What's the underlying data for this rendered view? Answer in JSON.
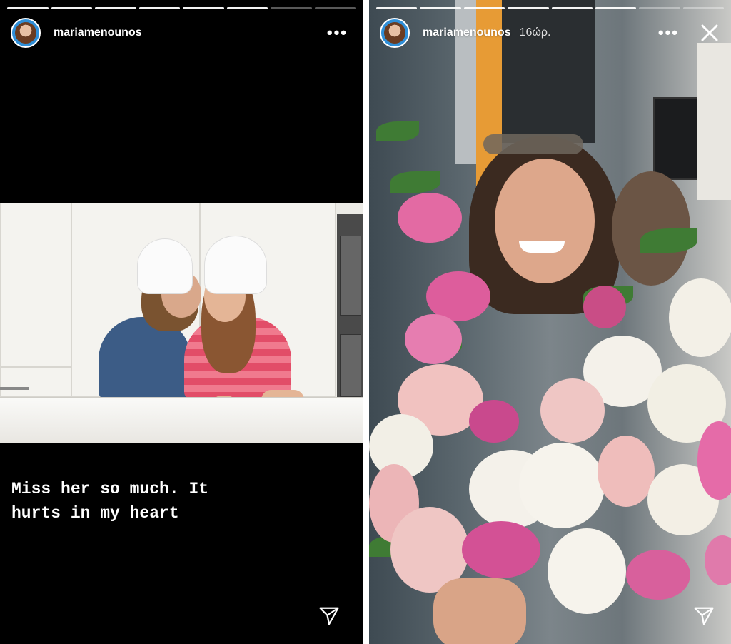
{
  "stories": [
    {
      "username": "mariamenounos",
      "timestamp": "",
      "more_label": "•••",
      "caption": "Miss her so much. It\nhurts in my heart",
      "progress": {
        "segments": 8,
        "completed": 6
      }
    },
    {
      "username": "mariamenounos",
      "timestamp": "16ώρ.",
      "more_label": "•••",
      "caption": "",
      "progress": {
        "segments": 8,
        "completed": 6
      }
    }
  ],
  "icons": {
    "avatar": "profile-avatar",
    "more": "more-options-icon",
    "close": "close-icon",
    "send": "send-direct-icon"
  },
  "colors": {
    "story_background": "#000000",
    "divider": "#ffffff",
    "text": "#ffffff",
    "avatar_ring": "#2f8fd8"
  }
}
